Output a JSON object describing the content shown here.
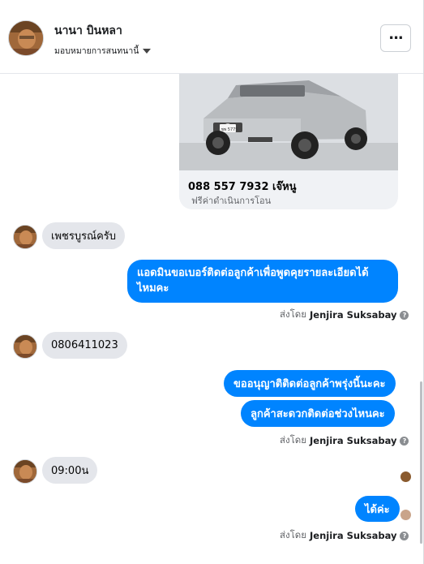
{
  "header": {
    "contact_name": "นานา บินหลา",
    "assign_label": "มอบหมายการสนทนานี้",
    "more_label": "..."
  },
  "card": {
    "plate_text": "ชพ 5775",
    "title": "088 557 7932 เจ๊หนู",
    "subtitle": "ฟรีค่าดำเนินการโอน"
  },
  "messages": {
    "m1": "เพชรบูรณ์ครับ",
    "m2_line1": "แอดมินขอเบอร์ติดต่อลูกค้าเพื่อพูดคุยรายละเอียดได้",
    "m2_line2": "ไหมคะ",
    "m3": "0806411023",
    "m4": "ขออนุญาติติดต่อลูกค้าพรุ่งนี้นะคะ",
    "m5": "ลูกค้าสะดวกติดต่อช่วงไหนคะ",
    "m6": "09:00น",
    "m7": "ได้ค่ะ"
  },
  "sent_by": {
    "prefix": "ส่งโดย",
    "name": "Jenjira Suksabay"
  },
  "colors": {
    "brand_blue": "#0084ff",
    "incoming_bubble": "#e4e6eb"
  }
}
